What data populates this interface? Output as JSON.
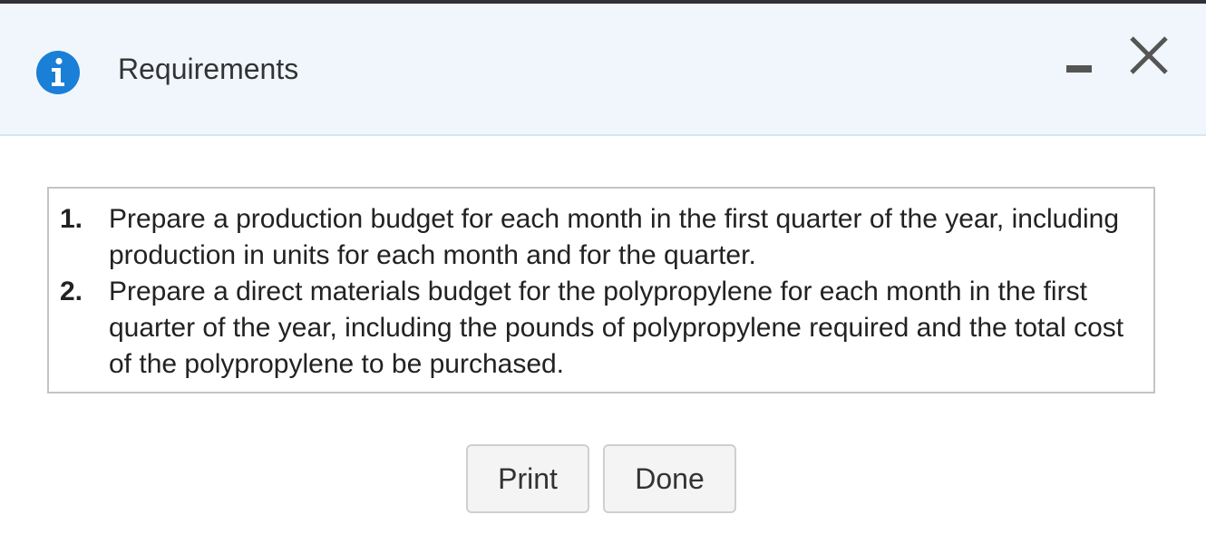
{
  "dialog": {
    "title": "Requirements",
    "icon": "info-icon"
  },
  "window_controls": {
    "minimize_icon": "minimize-icon",
    "close_icon": "close-icon"
  },
  "requirements": [
    {
      "number": "1.",
      "text": "Prepare a production budget for each month in the first quarter of the year, including production in units for each month and for the quarter."
    },
    {
      "number": "2.",
      "text": "Prepare a direct materials budget for the polypropylene for each month in the first quarter of the year, including the pounds of polypropylene required and the total cost of the polypropylene to be purchased."
    }
  ],
  "buttons": {
    "print_label": "Print",
    "done_label": "Done"
  },
  "colors": {
    "info_icon": "#1a7fd6",
    "header_bg": "#f1f6fd",
    "top_border": "#2f3136"
  }
}
